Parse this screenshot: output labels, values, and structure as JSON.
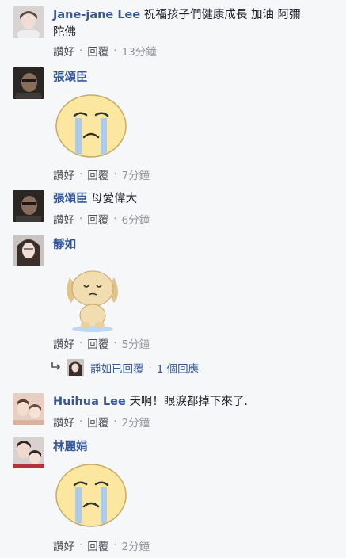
{
  "comments": [
    {
      "author": "Jane-jane Lee",
      "text_line1": "祝福孩子們健康成長 加油 阿彌",
      "text_line2": "陀佛",
      "like": "讚好",
      "reply": "回覆",
      "time": "13分鐘"
    },
    {
      "author": "張頌臣",
      "sticker": "crying-face-sticker",
      "like": "讚好",
      "reply": "回覆",
      "time": "7分鐘"
    },
    {
      "author": "張頌臣",
      "text": "母愛偉大",
      "like": "讚好",
      "reply": "回覆",
      "time": "6分鐘"
    },
    {
      "author": "靜如",
      "sticker": "sad-puppy-sticker",
      "like": "讚好",
      "reply": "回覆",
      "time": "5分鐘",
      "replies": {
        "text": "靜如已回覆",
        "count": "1 個回應"
      }
    },
    {
      "author": "Huihua Lee",
      "text": "天啊！眼淚都掉下來了.",
      "like": "讚好",
      "reply": "回覆",
      "time": "2分鐘"
    },
    {
      "author": "林麗娟",
      "sticker": "crying-face-sticker",
      "like": "讚好",
      "reply": "回覆",
      "time": "2分鐘"
    }
  ],
  "separator": "·",
  "colors": {
    "name": "#365899",
    "meta": "#90949c",
    "background": "#f6f7f9",
    "sticker_face": "#fbe7a0",
    "tears": "#a9cdf0"
  }
}
